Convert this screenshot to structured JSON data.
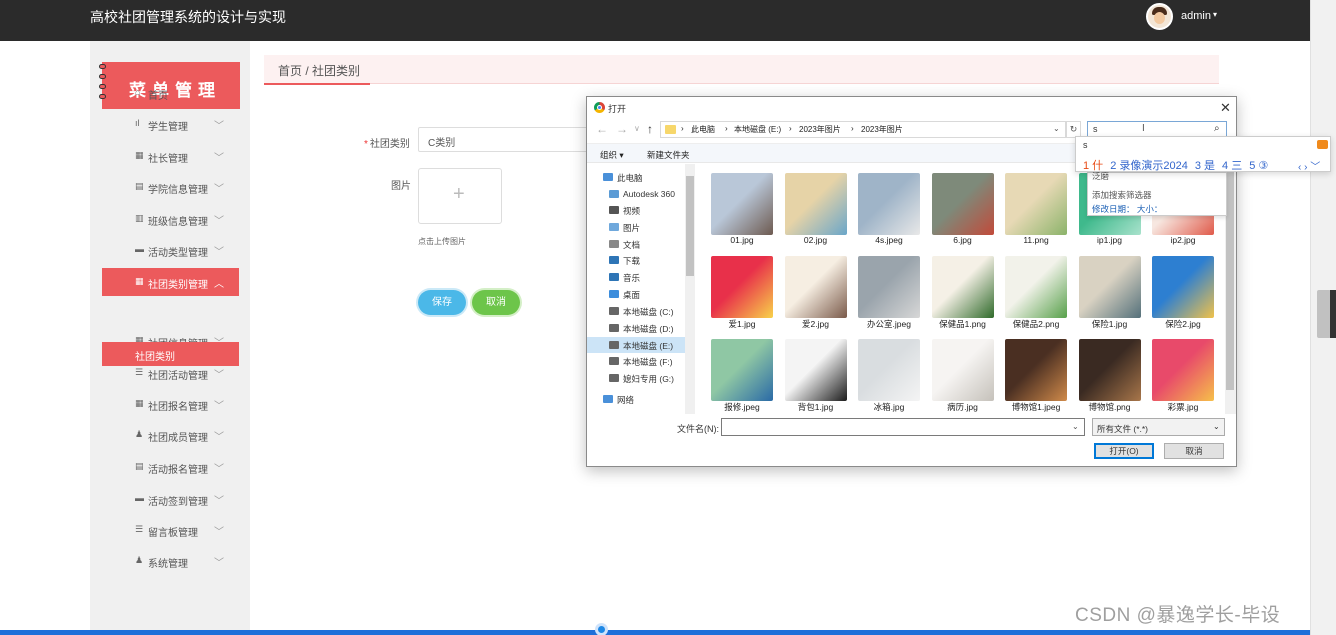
{
  "app": {
    "title": "高校社团管理系统的设计与实现",
    "user": "admin",
    "user_caret": "▾"
  },
  "sidebar": {
    "header": "菜单管理",
    "items": [
      {
        "icon": "⌂",
        "label": "首页",
        "chevron": ""
      },
      {
        "icon": "ıl",
        "label": "学生管理",
        "chevron": "﹀"
      },
      {
        "icon": "▦",
        "label": "社长管理",
        "chevron": "﹀"
      },
      {
        "icon": "▤",
        "label": "学院信息管理",
        "chevron": "﹀"
      },
      {
        "icon": "▥",
        "label": "班级信息管理",
        "chevron": "﹀"
      },
      {
        "icon": "▬",
        "label": "活动类型管理",
        "chevron": "﹀"
      },
      {
        "icon": "▦",
        "label": "社团类别管理",
        "chevron": "︿"
      },
      {
        "icon": "▦",
        "label": "社团信息管理",
        "chevron": "﹀"
      },
      {
        "icon": "☰",
        "label": "社团活动管理",
        "chevron": "﹀"
      },
      {
        "icon": "▦",
        "label": "社团报名管理",
        "chevron": "﹀"
      },
      {
        "icon": "♟",
        "label": "社团成员管理",
        "chevron": "﹀"
      },
      {
        "icon": "▤",
        "label": "活动报名管理",
        "chevron": "﹀"
      },
      {
        "icon": "▬",
        "label": "活动签到管理",
        "chevron": "﹀"
      },
      {
        "icon": "☰",
        "label": "留言板管理",
        "chevron": "﹀"
      },
      {
        "icon": "♟",
        "label": "系统管理",
        "chevron": "﹀"
      }
    ],
    "sub_item": "社团类别"
  },
  "breadcrumb": "首页 / 社团类别",
  "form": {
    "category_label": "社团类别",
    "category_value": "C类别",
    "image_label": "图片",
    "upload_plus": "+",
    "upload_tip": "点击上传图片",
    "save": "保存",
    "cancel": "取消"
  },
  "dialog": {
    "title": "打开",
    "close": "✕",
    "path": [
      "此电脑",
      "本地磁盘 (E:)",
      "2023年图片",
      "2023年图片"
    ],
    "search_value": "s",
    "organize": "组织 ▾",
    "new_folder": "新建文件夹",
    "nav": [
      {
        "label": "此电脑",
        "color": "#4a90d9"
      },
      {
        "label": "Autodesk 360",
        "color": "#5b9bd5"
      },
      {
        "label": "视频",
        "color": "#555"
      },
      {
        "label": "图片",
        "color": "#6fa8dc"
      },
      {
        "label": "文档",
        "color": "#888"
      },
      {
        "label": "下载",
        "color": "#2e75b6"
      },
      {
        "label": "音乐",
        "color": "#2e75b6"
      },
      {
        "label": "桌面",
        "color": "#3c8ddc"
      },
      {
        "label": "本地磁盘 (C:)",
        "color": "#666"
      },
      {
        "label": "本地磁盘 (D:)",
        "color": "#666"
      },
      {
        "label": "本地磁盘 (E:)",
        "color": "#666"
      },
      {
        "label": "本地磁盘 (F:)",
        "color": "#666"
      },
      {
        "label": "媳妇专用 (G:)",
        "color": "#666"
      },
      {
        "label": "网络",
        "color": "#4a90d9"
      }
    ],
    "files": [
      {
        "name": "01.jpg",
        "c1": "#b9c7d8",
        "c2": "#6d5a50"
      },
      {
        "name": "02.jpg",
        "c1": "#e6d3a7",
        "c2": "#6aa6c9"
      },
      {
        "name": "4s.jpeg",
        "c1": "#9fb4c8",
        "c2": "#e8e8e8"
      },
      {
        "name": "6.jpg",
        "c1": "#7e8a7a",
        "c2": "#c24a3a"
      },
      {
        "name": "11.png",
        "c1": "#e7d9b5",
        "c2": "#8bb36a"
      },
      {
        "name": "ip1.jpg",
        "c1": "#3fb98c",
        "c2": "#a9e2cc"
      },
      {
        "name": "ip2.jpg",
        "c1": "#f7e7e0",
        "c2": "#e05a4a"
      },
      {
        "name": "爱1.jpg",
        "c1": "#e8304a",
        "c2": "#f8d24a"
      },
      {
        "name": "爱2.jpg",
        "c1": "#f6eee2",
        "c2": "#7a5a4a"
      },
      {
        "name": "办公室.jpeg",
        "c1": "#9aa4ac",
        "c2": "#d7d7d7"
      },
      {
        "name": "保健品1.png",
        "c1": "#f5f0e6",
        "c2": "#2f6a2a"
      },
      {
        "name": "保健品2.png",
        "c1": "#f2f2ea",
        "c2": "#57a04a"
      },
      {
        "name": "保险1.jpg",
        "c1": "#d9d2c2",
        "c2": "#54707a"
      },
      {
        "name": "保险2.jpg",
        "c1": "#2d7fd1",
        "c2": "#f0c24a"
      },
      {
        "name": "报修.jpeg",
        "c1": "#8fc7a4",
        "c2": "#2a6aa6"
      },
      {
        "name": "背包1.jpg",
        "c1": "#f4f4f4",
        "c2": "#1b1b1b"
      },
      {
        "name": "冰箱.jpg",
        "c1": "#d9dde0",
        "c2": "#f4f4f4"
      },
      {
        "name": "病历.jpg",
        "c1": "#f6f4f2",
        "c2": "#c5c1ba"
      },
      {
        "name": "博物馆1.jpeg",
        "c1": "#4a2f22",
        "c2": "#d08a4a"
      },
      {
        "name": "博物馆.png",
        "c1": "#3a2a22",
        "c2": "#a8764a"
      },
      {
        "name": "彩票.jpg",
        "c1": "#e84a6a",
        "c2": "#f6c04a"
      }
    ],
    "filename_label": "文件名(N):",
    "filename_value": "",
    "filetype": "所有文件 (*.*)",
    "open": "打开(O)",
    "cancel": "取消"
  },
  "ime": {
    "pinyin": "s",
    "candidates": [
      {
        "text": "1 什"
      },
      {
        "text": "2 录像演示2024"
      },
      {
        "text": "3 是"
      },
      {
        "text": "4 三"
      },
      {
        "text": "5 ③"
      }
    ],
    "nav": "‹ › ﹀",
    "tooltip_top": "泛磨",
    "tooltip_filter": "添加搜索筛选器",
    "tooltip_fields": "修改日期：   大小："
  },
  "watermark": "CSDN @暴逸学长-毕设"
}
